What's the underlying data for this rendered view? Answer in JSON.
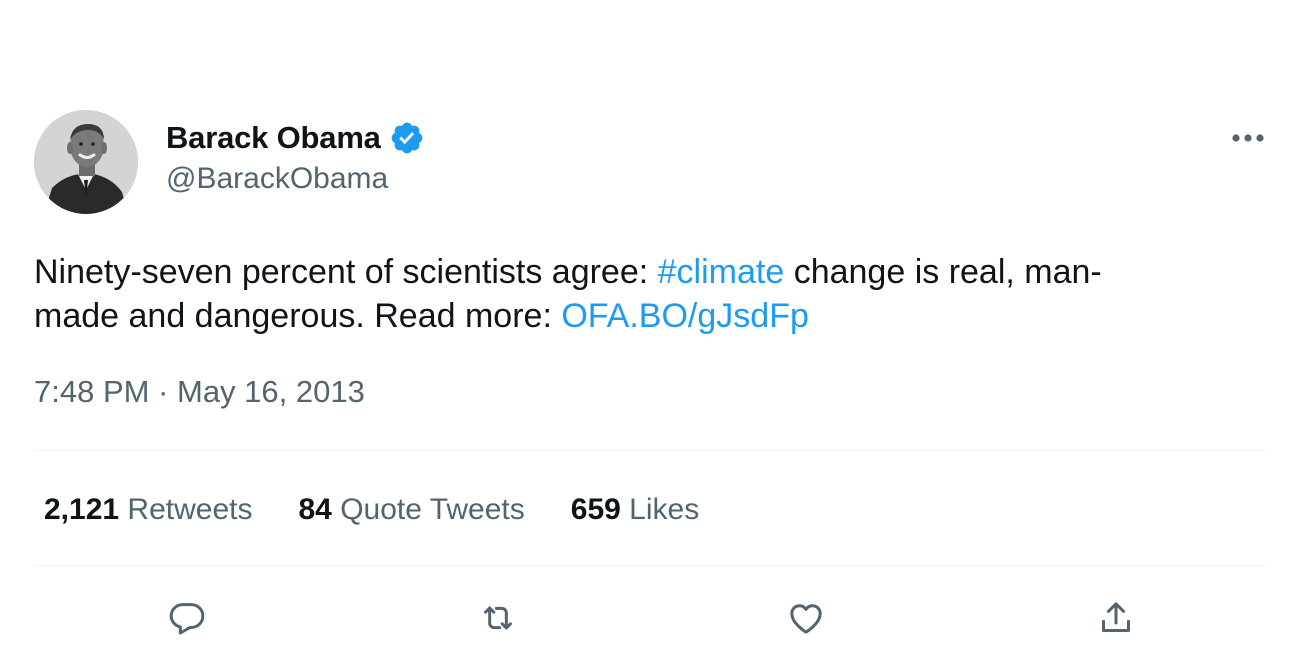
{
  "tweet": {
    "display_name": "Barack Obama",
    "handle": "@BarackObama",
    "text_line1_before": "Ninety-seven percent of scientists agree: ",
    "hashtag": "#climate",
    "text_line1_after": " change is real, man-",
    "text_line2_before": "made and dangerous. Read more: ",
    "link": "OFA.BO/gJsdFp",
    "timestamp": "7:48 PM · May 16, 2013"
  },
  "stats": {
    "retweets_count": "2,121",
    "retweets_label": "Retweets",
    "quotes_count": "84",
    "quotes_label": "Quote Tweets",
    "likes_count": "659",
    "likes_label": "Likes"
  },
  "icons": {
    "verified": "verified-badge-icon",
    "more": "more-horizontal-icon",
    "reply": "reply-icon",
    "retweet": "retweet-icon",
    "like": "heart-icon",
    "share": "share-icon"
  },
  "colors": {
    "accent": "#1d9bf0",
    "text_primary": "#0f1419",
    "text_secondary": "#536471",
    "divider": "#eff3f4"
  }
}
